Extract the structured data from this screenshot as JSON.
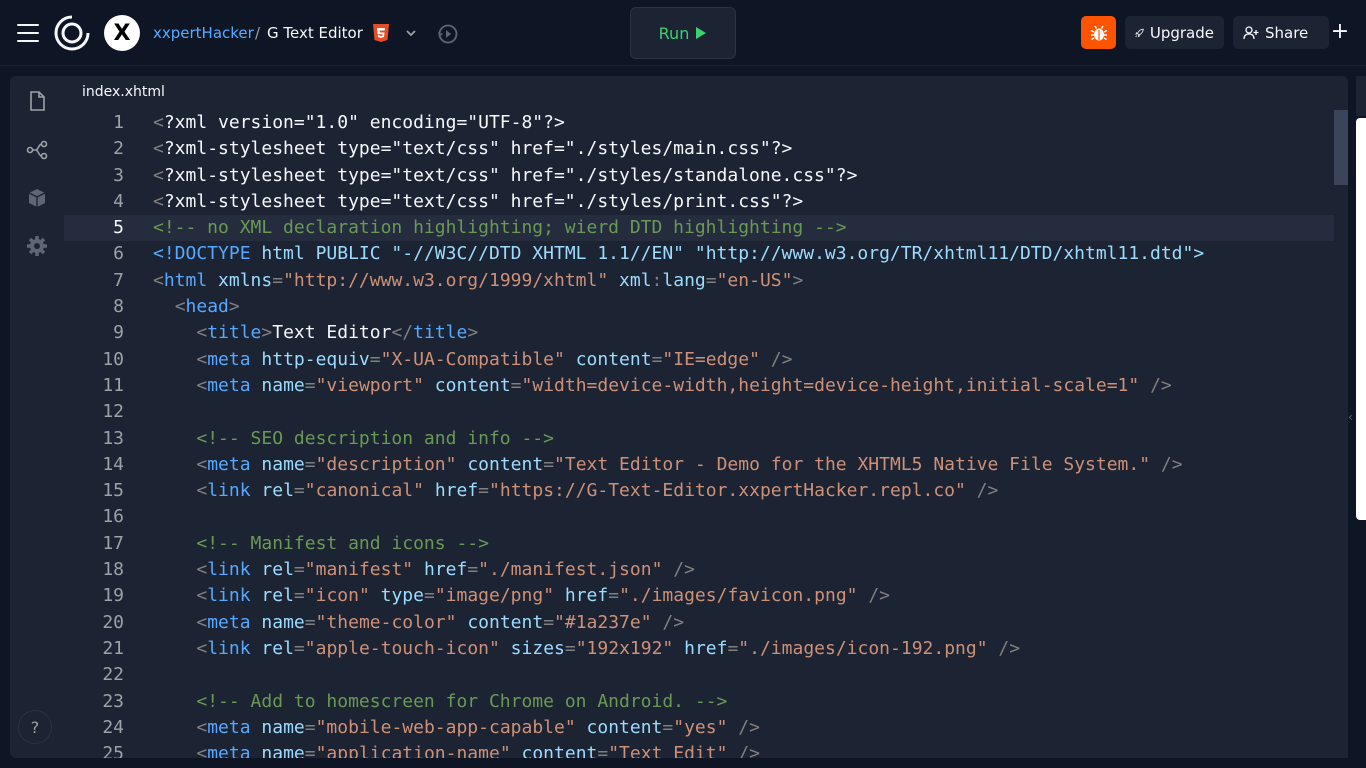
{
  "header": {
    "owner": "xxpertHacker",
    "separator": "/",
    "repl_name": "G Text Editor",
    "avatar_letter": "X",
    "run_label": "Run",
    "upgrade_label": "Upgrade",
    "share_label": "Share",
    "plus_label": "+"
  },
  "sidebar": {
    "help_label": "?",
    "items": [
      {
        "icon": "file-icon"
      },
      {
        "icon": "git-icon"
      },
      {
        "icon": "packages-icon"
      },
      {
        "icon": "settings-icon"
      }
    ]
  },
  "editor": {
    "tab": "index.xhtml",
    "active_line": 5,
    "lines": [
      {
        "n": "1",
        "tokens": [
          [
            "pun",
            "<"
          ],
          [
            "txt",
            "?xml version=\"1.0\" encoding=\"UTF-8\"?>"
          ]
        ]
      },
      {
        "n": "2",
        "tokens": [
          [
            "pun",
            "<"
          ],
          [
            "txt",
            "?xml-stylesheet type=\"text/css\" href=\"./styles/main.css\"?>"
          ]
        ]
      },
      {
        "n": "3",
        "tokens": [
          [
            "pun",
            "<"
          ],
          [
            "txt",
            "?xml-stylesheet type=\"text/css\" href=\"./styles/standalone.css\"?>"
          ]
        ]
      },
      {
        "n": "4",
        "tokens": [
          [
            "pun",
            "<"
          ],
          [
            "txt",
            "?xml-stylesheet type=\"text/css\" href=\"./styles/print.css\"?>"
          ]
        ]
      },
      {
        "n": "5",
        "tokens": [
          [
            "com",
            "<!-- no XML declaration highlighting; wierd DTD highlighting -->"
          ]
        ]
      },
      {
        "n": "6",
        "tokens": [
          [
            "tag",
            "<!DOCTYPE"
          ],
          [
            "attr",
            " html PUBLIC \"-//W3C//DTD XHTML 1.1//EN\" \"http://www.w3.org/TR/xhtml11/DTD/xhtml11.dtd\">"
          ]
        ]
      },
      {
        "n": "7",
        "tokens": [
          [
            "pun",
            "<"
          ],
          [
            "tag",
            "html"
          ],
          [
            "attr",
            " xmlns"
          ],
          [
            "pun",
            "="
          ],
          [
            "str",
            "\"http://www.w3.org/1999/xhtml\""
          ],
          [
            "attr",
            " xml"
          ],
          [
            "pun",
            ":"
          ],
          [
            "attr",
            "lang"
          ],
          [
            "pun",
            "="
          ],
          [
            "str",
            "\"en-US\""
          ],
          [
            "pun",
            ">"
          ]
        ]
      },
      {
        "n": "8",
        "tokens": [
          [
            "txt",
            "  "
          ],
          [
            "pun",
            "<"
          ],
          [
            "tag",
            "head"
          ],
          [
            "pun",
            ">"
          ]
        ]
      },
      {
        "n": "9",
        "tokens": [
          [
            "txt",
            "    "
          ],
          [
            "pun",
            "<"
          ],
          [
            "tag",
            "title"
          ],
          [
            "pun",
            ">"
          ],
          [
            "txt",
            "Text Editor"
          ],
          [
            "pun",
            "</"
          ],
          [
            "tag",
            "title"
          ],
          [
            "pun",
            ">"
          ]
        ]
      },
      {
        "n": "10",
        "tokens": [
          [
            "txt",
            "    "
          ],
          [
            "pun",
            "<"
          ],
          [
            "tag",
            "meta"
          ],
          [
            "attr",
            " http-equiv"
          ],
          [
            "pun",
            "="
          ],
          [
            "str",
            "\"X-UA-Compatible\""
          ],
          [
            "attr",
            " content"
          ],
          [
            "pun",
            "="
          ],
          [
            "str",
            "\"IE=edge\""
          ],
          [
            "pun",
            " />"
          ]
        ]
      },
      {
        "n": "11",
        "tokens": [
          [
            "txt",
            "    "
          ],
          [
            "pun",
            "<"
          ],
          [
            "tag",
            "meta"
          ],
          [
            "attr",
            " name"
          ],
          [
            "pun",
            "="
          ],
          [
            "str",
            "\"viewport\""
          ],
          [
            "attr",
            " content"
          ],
          [
            "pun",
            "="
          ],
          [
            "str",
            "\"width=device-width,height=device-height,initial-scale=1\""
          ],
          [
            "pun",
            " />"
          ]
        ]
      },
      {
        "n": "12",
        "tokens": []
      },
      {
        "n": "13",
        "tokens": [
          [
            "txt",
            "    "
          ],
          [
            "com",
            "<!-- SEO description and info -->"
          ]
        ]
      },
      {
        "n": "14",
        "tokens": [
          [
            "txt",
            "    "
          ],
          [
            "pun",
            "<"
          ],
          [
            "tag",
            "meta"
          ],
          [
            "attr",
            " name"
          ],
          [
            "pun",
            "="
          ],
          [
            "str",
            "\"description\""
          ],
          [
            "attr",
            " content"
          ],
          [
            "pun",
            "="
          ],
          [
            "str",
            "\"Text Editor - Demo for the XHTML5 Native File System.\""
          ],
          [
            "pun",
            " />"
          ]
        ]
      },
      {
        "n": "15",
        "tokens": [
          [
            "txt",
            "    "
          ],
          [
            "pun",
            "<"
          ],
          [
            "tag",
            "link"
          ],
          [
            "attr",
            " rel"
          ],
          [
            "pun",
            "="
          ],
          [
            "str",
            "\"canonical\""
          ],
          [
            "attr",
            " href"
          ],
          [
            "pun",
            "="
          ],
          [
            "str",
            "\"https://G-Text-Editor.xxpertHacker.repl.co\""
          ],
          [
            "pun",
            " />"
          ]
        ]
      },
      {
        "n": "16",
        "tokens": []
      },
      {
        "n": "17",
        "tokens": [
          [
            "txt",
            "    "
          ],
          [
            "com",
            "<!-- Manifest and icons -->"
          ]
        ]
      },
      {
        "n": "18",
        "tokens": [
          [
            "txt",
            "    "
          ],
          [
            "pun",
            "<"
          ],
          [
            "tag",
            "link"
          ],
          [
            "attr",
            " rel"
          ],
          [
            "pun",
            "="
          ],
          [
            "str",
            "\"manifest\""
          ],
          [
            "attr",
            " href"
          ],
          [
            "pun",
            "="
          ],
          [
            "str",
            "\"./manifest.json\""
          ],
          [
            "pun",
            " />"
          ]
        ]
      },
      {
        "n": "19",
        "tokens": [
          [
            "txt",
            "    "
          ],
          [
            "pun",
            "<"
          ],
          [
            "tag",
            "link"
          ],
          [
            "attr",
            " rel"
          ],
          [
            "pun",
            "="
          ],
          [
            "str",
            "\"icon\""
          ],
          [
            "attr",
            " type"
          ],
          [
            "pun",
            "="
          ],
          [
            "str",
            "\"image/png\""
          ],
          [
            "attr",
            " href"
          ],
          [
            "pun",
            "="
          ],
          [
            "str",
            "\"./images/favicon.png\""
          ],
          [
            "pun",
            " />"
          ]
        ]
      },
      {
        "n": "20",
        "tokens": [
          [
            "txt",
            "    "
          ],
          [
            "pun",
            "<"
          ],
          [
            "tag",
            "meta"
          ],
          [
            "attr",
            " name"
          ],
          [
            "pun",
            "="
          ],
          [
            "str",
            "\"theme-color\""
          ],
          [
            "attr",
            " content"
          ],
          [
            "pun",
            "="
          ],
          [
            "str",
            "\"#1a237e\""
          ],
          [
            "pun",
            " />"
          ]
        ]
      },
      {
        "n": "21",
        "tokens": [
          [
            "txt",
            "    "
          ],
          [
            "pun",
            "<"
          ],
          [
            "tag",
            "link"
          ],
          [
            "attr",
            " rel"
          ],
          [
            "pun",
            "="
          ],
          [
            "str",
            "\"apple-touch-icon\""
          ],
          [
            "attr",
            " sizes"
          ],
          [
            "pun",
            "="
          ],
          [
            "str",
            "\"192x192\""
          ],
          [
            "attr",
            " href"
          ],
          [
            "pun",
            "="
          ],
          [
            "str",
            "\"./images/icon-192.png\""
          ],
          [
            "pun",
            " />"
          ]
        ]
      },
      {
        "n": "22",
        "tokens": []
      },
      {
        "n": "23",
        "tokens": [
          [
            "txt",
            "    "
          ],
          [
            "com",
            "<!-- Add to homescreen for Chrome on Android. -->"
          ]
        ]
      },
      {
        "n": "24",
        "tokens": [
          [
            "txt",
            "    "
          ],
          [
            "pun",
            "<"
          ],
          [
            "tag",
            "meta"
          ],
          [
            "attr",
            " name"
          ],
          [
            "pun",
            "="
          ],
          [
            "str",
            "\"mobile-web-app-capable\""
          ],
          [
            "attr",
            " content"
          ],
          [
            "pun",
            "="
          ],
          [
            "str",
            "\"yes\""
          ],
          [
            "pun",
            " />"
          ]
        ]
      },
      {
        "n": "25",
        "tokens": [
          [
            "txt",
            "    "
          ],
          [
            "pun",
            "<"
          ],
          [
            "tag",
            "meta"
          ],
          [
            "attr",
            " name"
          ],
          [
            "pun",
            "="
          ],
          [
            "str",
            "\"application-name\""
          ],
          [
            "attr",
            " content"
          ],
          [
            "pun",
            "="
          ],
          [
            "str",
            "\"Text Edit\""
          ],
          [
            "pun",
            " />"
          ]
        ]
      }
    ]
  },
  "colors": {
    "background": "#0e1525",
    "surface": "#1c2333",
    "run_green": "#39d26e",
    "bug_orange": "#fd5402",
    "owner_link": "#57abff"
  }
}
